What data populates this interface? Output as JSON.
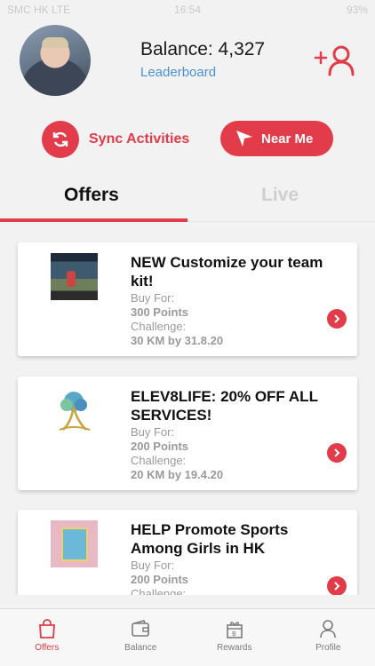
{
  "status_bar": {
    "carrier": "SMC HK  LTE",
    "time": "16:54",
    "battery": "93%"
  },
  "profile": {
    "balance_text": "Balance: 4,327",
    "leaderboard_label": "Leaderboard"
  },
  "actions": {
    "sync_label": "Sync Activities",
    "near_label": "Near Me"
  },
  "tabs": {
    "offers": "Offers",
    "live": "Live",
    "active": "offers"
  },
  "offers": [
    {
      "title": "NEW Customize your team kit!",
      "buy_label": "Buy For:",
      "price": "300 Points",
      "challenge_label": "Challenge:",
      "challenge": "30 KM by 31.8.20"
    },
    {
      "title": "ELEV8LIFE: 20% OFF ALL SERVICES!",
      "buy_label": "Buy For:",
      "price": "200 Points",
      "challenge_label": "Challenge:",
      "challenge": "20 KM by 19.4.20"
    },
    {
      "title": "HELP Promote Sports Among Girls in HK",
      "buy_label": "Buy For:",
      "price": "200 Points",
      "challenge_label": "Challenge:",
      "challenge": ""
    }
  ],
  "tabbar": {
    "offers": "Offers",
    "balance": "Balance",
    "rewards": "Rewards",
    "profile": "Profile",
    "active": "offers"
  },
  "colors": {
    "accent": "#e23b4a",
    "link": "#4a90d9"
  }
}
